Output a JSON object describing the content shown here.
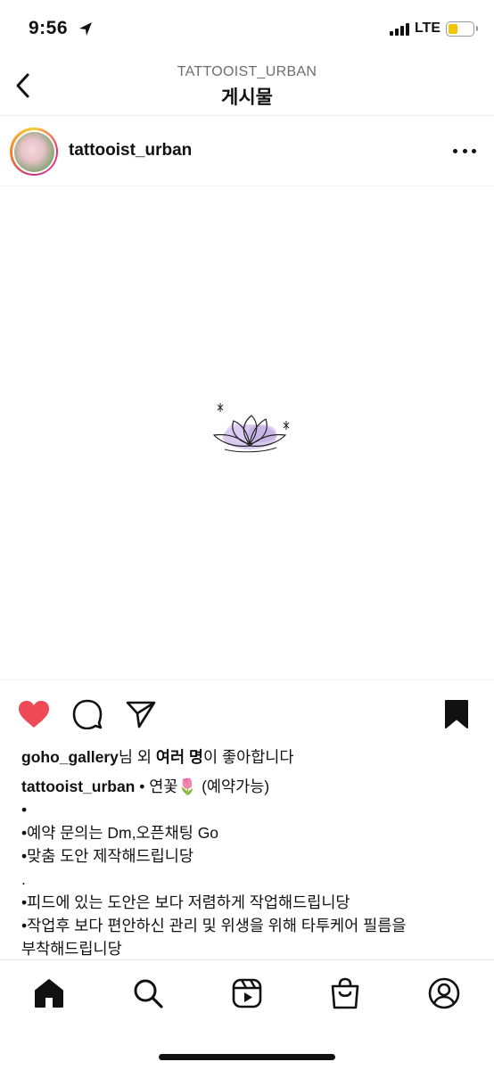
{
  "status_bar": {
    "time": "9:56",
    "network": "LTE",
    "location_icon": "location-arrow-icon",
    "battery_color": "#f5c400"
  },
  "header": {
    "subtitle": "TATTOOIST_URBAN",
    "title": "게시물",
    "back_icon": "chevron-left-icon"
  },
  "post": {
    "username": "tattooist_urban",
    "more_icon": "ellipsis-icon",
    "image_icon": "lotus-flower-illustration"
  },
  "actions": {
    "like_icon": "heart-filled-icon",
    "like_color": "#ed4956",
    "comment_icon": "comment-icon",
    "share_icon": "send-icon",
    "save_icon": "bookmark-filled-icon"
  },
  "likes": {
    "user": "goho_gallery",
    "text1": "님 외 ",
    "others": "여러 명",
    "text2": "이 좋아합니다"
  },
  "caption": {
    "username": "tattooist_urban",
    "first_line": " • 연꽃🌷 (예약가능)",
    "lines": [
      "•",
      "•예약 문의는 Dm,오픈채팅 Go",
      "•맞춤 도안 제작해드립니당",
      ".",
      "•피드에 있는 도안은 보다 저렴하게 작업해드립니당",
      "•작업후 보다 편안하신 관리 및 위생을 위해 타투케어 필름을",
      "부착해드립니당"
    ]
  },
  "tabbar": {
    "items": [
      "home-icon",
      "search-icon",
      "reels-icon",
      "shop-icon",
      "profile-icon"
    ]
  }
}
